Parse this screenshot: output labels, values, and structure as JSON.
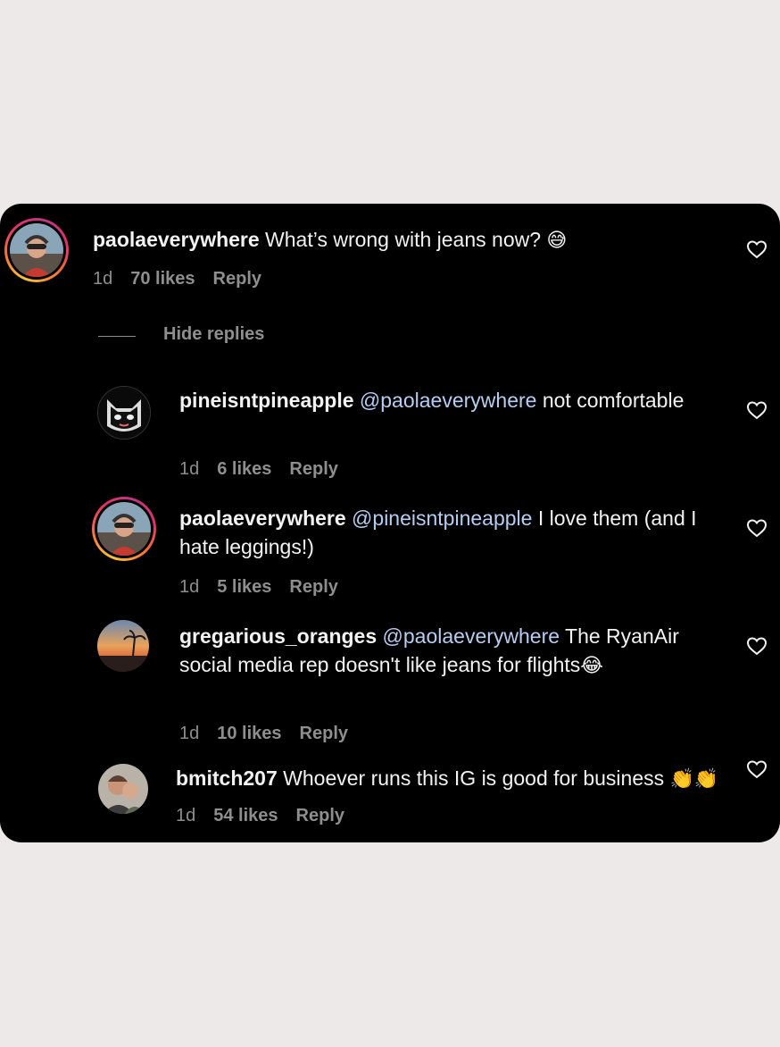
{
  "comments": [
    {
      "username": "paolaeverywhere",
      "mention": "",
      "text": " What’s wrong with jeans now? ",
      "emoji": "😅",
      "time": "1d",
      "likes": "70 likes",
      "reply": "Reply"
    },
    {
      "username": "pineisntpineapple",
      "mention": " @paolaeverywhere",
      "text": " not comfortable",
      "emoji": "",
      "time": "1d",
      "likes": "6 likes",
      "reply": "Reply"
    },
    {
      "username": "paolaeverywhere",
      "mention": " @pineisntpineapple",
      "text": " I love them (and I hate leggings!)",
      "emoji": "",
      "time": "1d",
      "likes": "5 likes",
      "reply": "Reply"
    },
    {
      "username": "gregarious_oranges",
      "mention": " @paolaeverywhere",
      "text": " The RyanAir social media rep doesn't like jeans for flights",
      "emoji": "😂",
      "time": "1d",
      "likes": "10 likes",
      "reply": "Reply"
    },
    {
      "username": "bmitch207",
      "mention": "",
      "text": " Whoever runs this IG is good for business ",
      "emoji": "👏👏",
      "time": "1d",
      "likes": "54 likes",
      "reply": "Reply"
    }
  ],
  "hide_replies": "Hide replies",
  "icons": {
    "like": "heart-outline-icon"
  },
  "colors": {
    "background": "#000000",
    "mention": "#b6cdf1",
    "meta": "#8e8e8e"
  }
}
